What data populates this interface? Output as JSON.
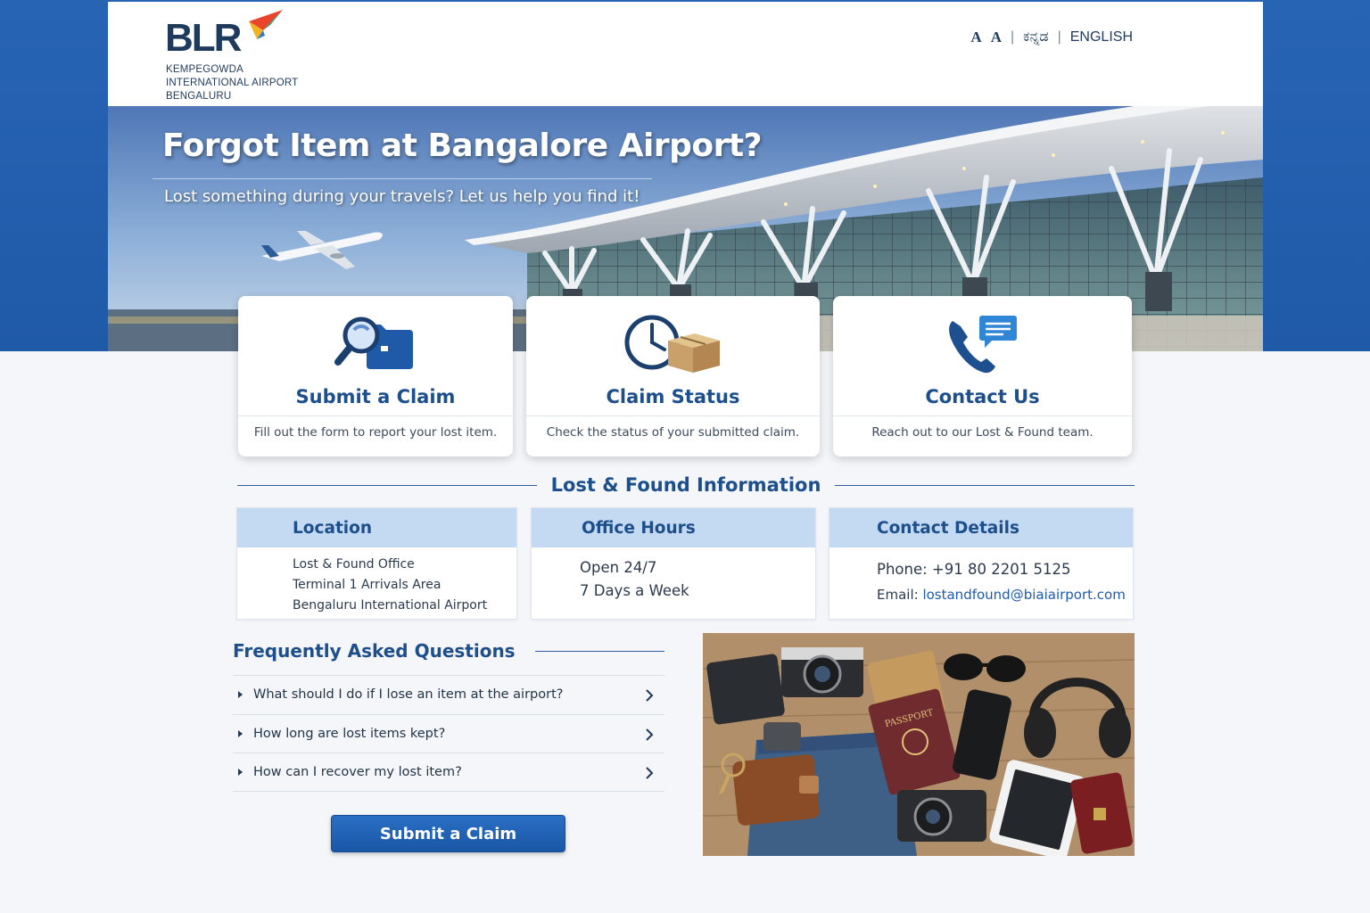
{
  "header": {
    "logo": {
      "letters": "BLR",
      "subtitle_lines": [
        "KEMPEGOWDA",
        "INTERNATIONAL AIRPORT",
        "BENGALURU"
      ]
    },
    "font_size_toggles": [
      "A",
      "A"
    ],
    "separator": "|",
    "languages": [
      "ಕನ್ನಡ",
      "ENGLISH"
    ]
  },
  "hero": {
    "title": "Forgot Item at Bangalore Airport?",
    "subtitle": "Lost something during your travels? Let us help you find it!"
  },
  "action_cards": [
    {
      "title": "Submit a Claim",
      "description": "Fill out the form to report your lost item.",
      "icon": "search-folder-icon"
    },
    {
      "title": "Claim Status",
      "description": "Check the status of your submitted claim.",
      "icon": "clock-package-icon"
    },
    {
      "title": "Contact Us",
      "description": "Reach out to our Lost & Found team.",
      "icon": "phone-chat-icon"
    }
  ],
  "info_section": {
    "title": "Lost & Found Information",
    "location": {
      "heading": "Location",
      "lines": [
        "Lost & Found Office",
        "Terminal 1 Arrivals Area",
        "Bengaluru International Airport"
      ]
    },
    "office_hours": {
      "heading": "Office Hours",
      "lines": [
        "Open 24/7",
        "7 Days a Week"
      ]
    },
    "contact_details": {
      "heading": "Contact Details",
      "phone_label": "Phone:",
      "phone": "+91 80 2201 5125",
      "email_label": "Email:",
      "email": "lostandfound@biaiairport.com"
    }
  },
  "faq": {
    "title": "Frequently Asked Questions",
    "items": [
      "What should I do if I lose an item at the airport?",
      "How long are lost items kept?",
      "How can I recover my lost item?"
    ]
  },
  "cta": {
    "submit_label": "Submit a Claim"
  },
  "photo_labels": {
    "passport": "PASSPORT"
  },
  "colors": {
    "brand_blue": "#1f5aa8",
    "heading_blue": "#1d4f8c",
    "info_header_bg": "#c4daf2",
    "button_blue": "#1a56a6"
  }
}
